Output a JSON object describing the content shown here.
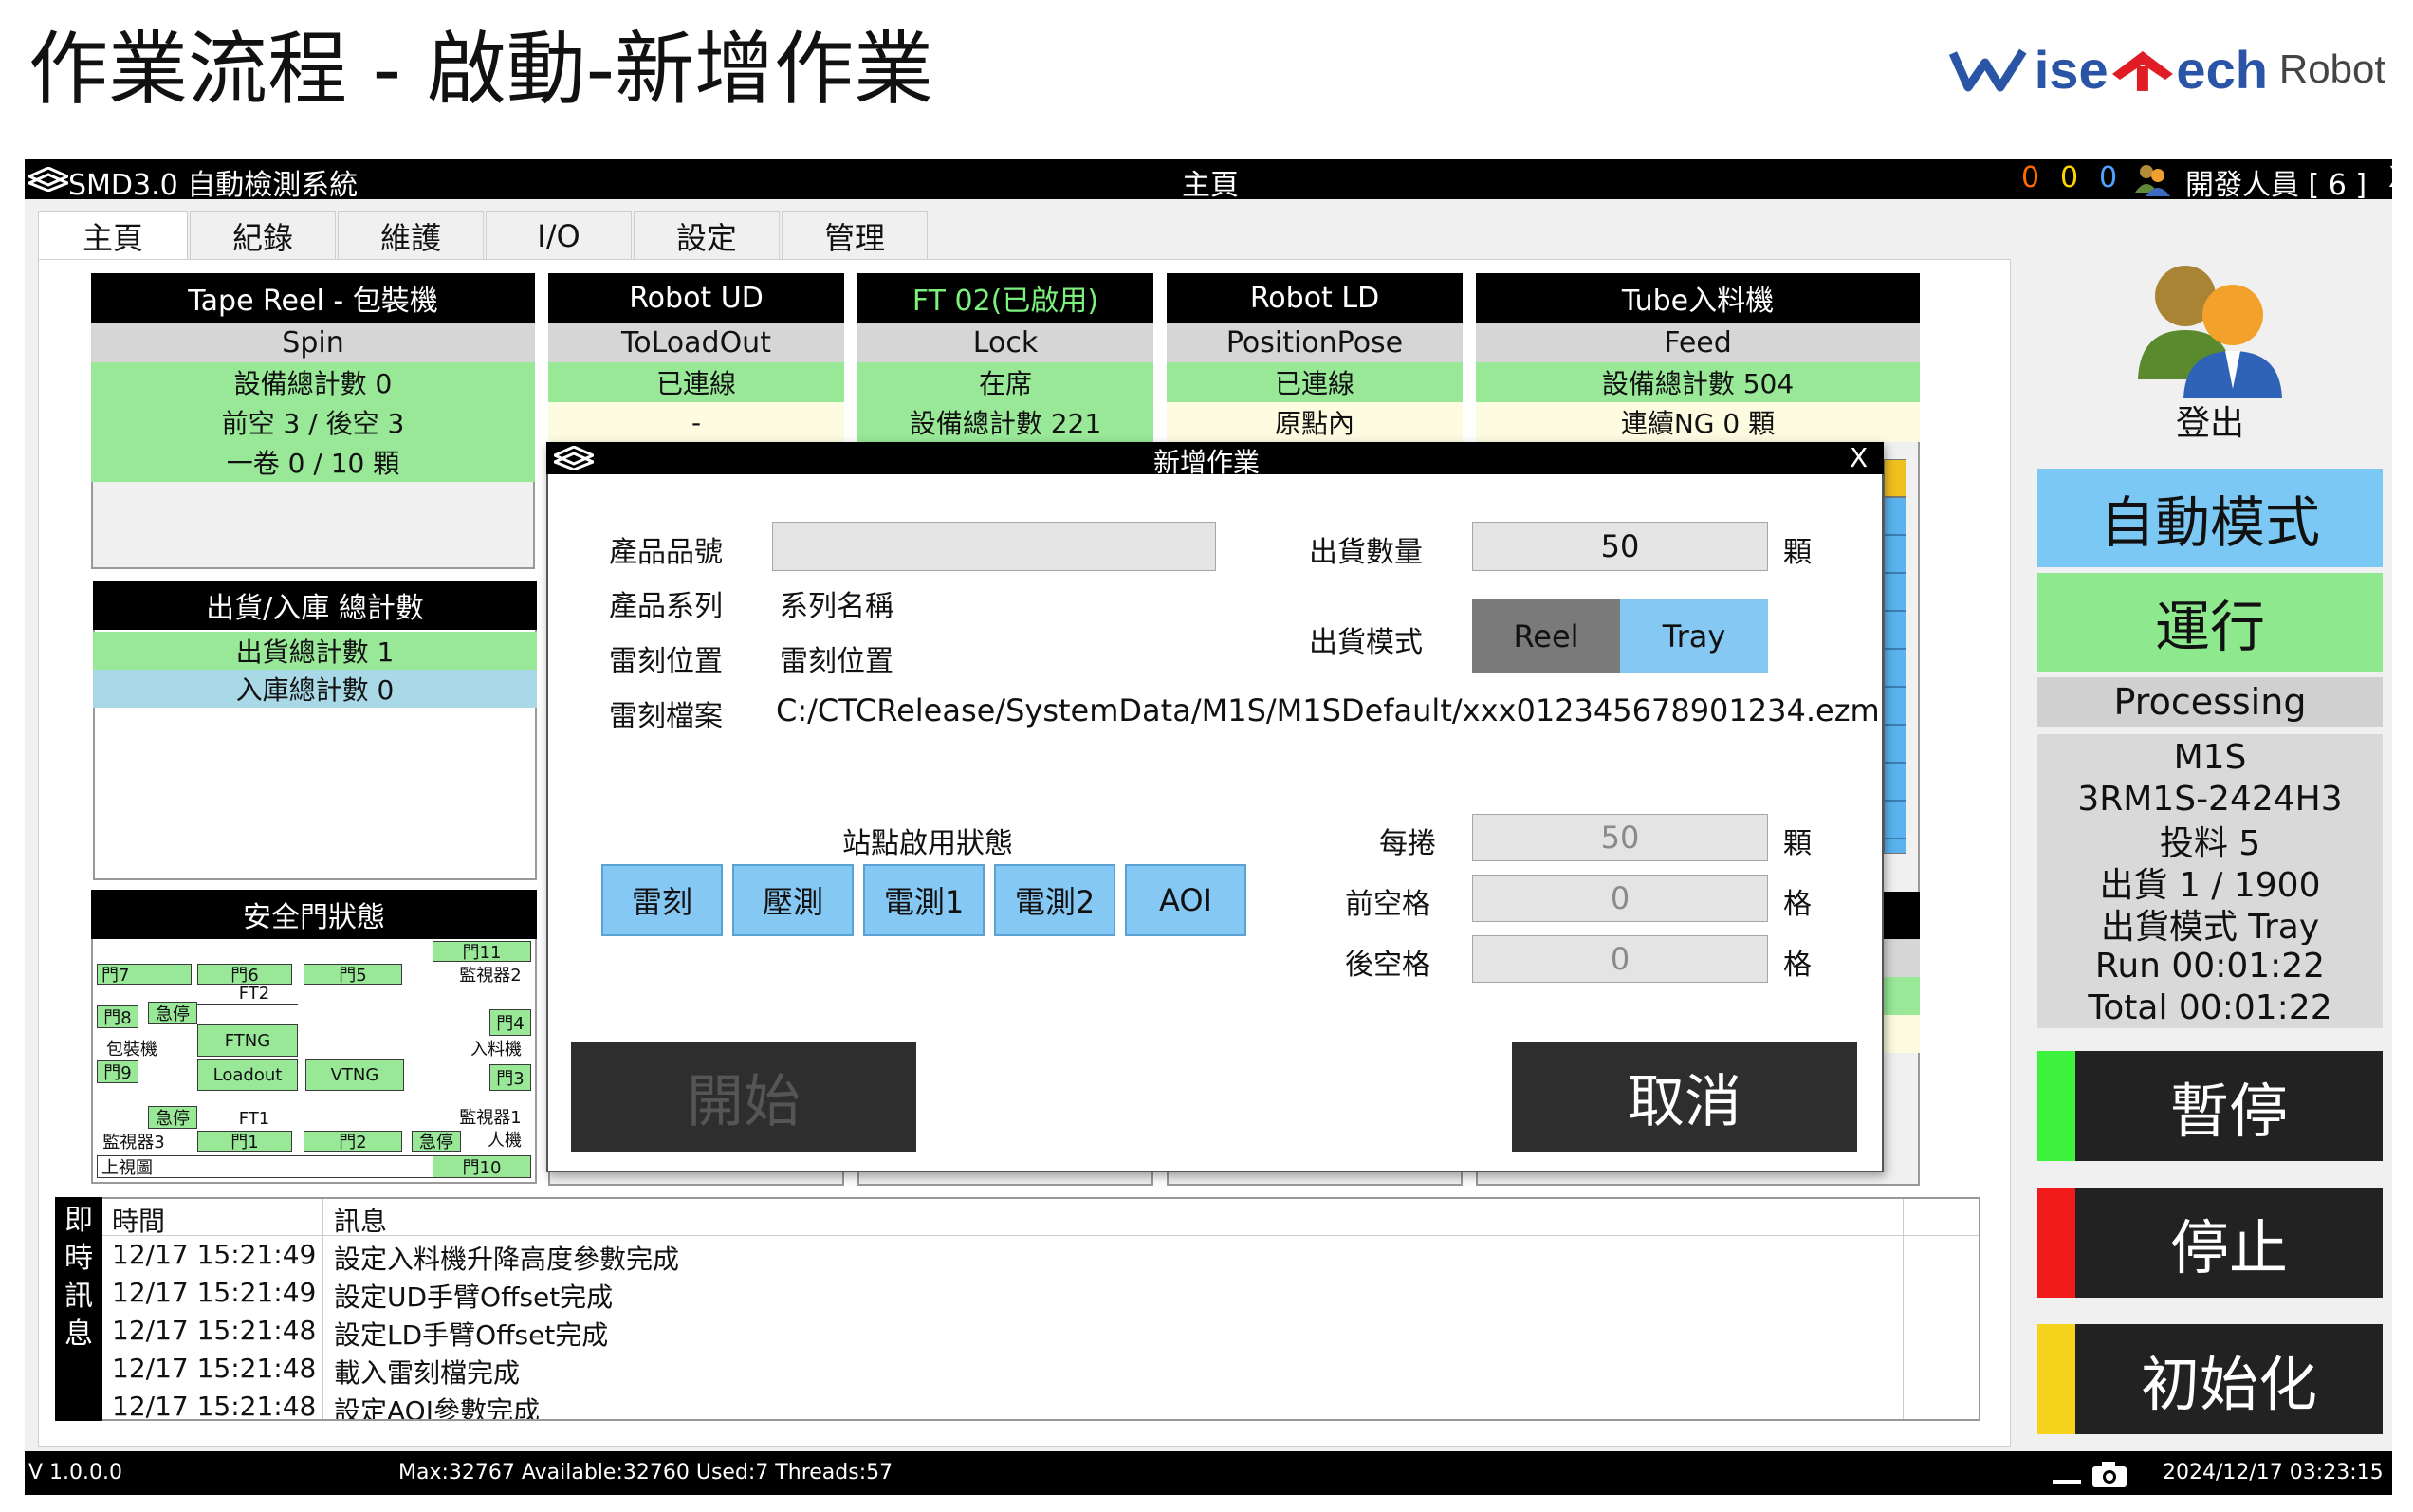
{
  "slide": {
    "title": "作業流程 - 啟動-新增作業",
    "logo": {
      "part1": "ise",
      "part2": "ech",
      "suffix": "Robot"
    }
  },
  "app": {
    "title": "SMD3.0 自動檢測系統",
    "center_title": "主頁",
    "counters": [
      "0",
      "0",
      "0"
    ],
    "counter_colors": [
      "#ff6a00",
      "#ffd400",
      "#4fa3ff"
    ],
    "user": "開發人員 [ 6 ]",
    "close": "X"
  },
  "tabs": [
    "主頁",
    "紀錄",
    "維護",
    "I/O",
    "設定",
    "管理"
  ],
  "stations": [
    {
      "header": "Tape Reel - 包裝機",
      "state": "Spin",
      "rows": [
        "設備總計數 0",
        "前空 3 / 後空 3",
        "一卷 0 / 10 顆"
      ]
    },
    {
      "header": "Robot UD",
      "state": "ToLoadOut",
      "rows": [
        "已連線",
        "-"
      ]
    },
    {
      "header": "FT 02(已啟用)",
      "state": "Lock",
      "rows": [
        "在席",
        "設備總計數 221"
      ]
    },
    {
      "header": "Robot LD",
      "state": "PositionPose",
      "rows": [
        "已連線",
        "原點內"
      ]
    },
    {
      "header": "Tube入料機",
      "state": "Feed",
      "rows": [
        "設備總計數 504",
        "連續NG 0 顆"
      ]
    }
  ],
  "totals": {
    "header": "出貨/入庫 總計數",
    "out": "出貨總計數 1",
    "in": "入庫總計數 0"
  },
  "safety": {
    "header": "安全門狀態",
    "labels": {
      "door11": "門11",
      "door7": "門7",
      "door6": "門6",
      "door5": "門5",
      "monitor2": "監視器2",
      "ft2": "FT2",
      "door8": "門8",
      "estop1": "急停",
      "door4": "門4",
      "packer": "包裝機",
      "ftng": "FTNG",
      "feeder": "入料機",
      "door9": "門9",
      "loadout": "Loadout",
      "vtng": "VTNG",
      "door3": "門3",
      "estop2": "急停",
      "ft1": "FT1",
      "monitor1": "監視器1",
      "monitor3": "監視器3",
      "door1": "門1",
      "door2": "門2",
      "estop3": "急停",
      "person": "人機",
      "topview": "上視圖",
      "door10": "門10"
    }
  },
  "dialog": {
    "title": "新增作業",
    "close": "X",
    "product_no_label": "產品品號",
    "product_no_value": "",
    "series_label": "產品系列",
    "series_value": "系列名稱",
    "laser_pos_label": "雷刻位置",
    "laser_pos_value": "雷刻位置",
    "laser_file_label": "雷刻檔案",
    "laser_file_value": "C:/CTCRelease/SystemData/M1S/M1SDefault/xxx012345678901234.ezm",
    "qty_label": "出貨數量",
    "qty_value": "50",
    "qty_unit": "顆",
    "mode_label": "出貨模式",
    "mode_reel": "Reel",
    "mode_tray": "Tray",
    "station_label": "站點啟用狀態",
    "station_buttons": [
      "雷刻",
      "壓測",
      "電測1",
      "電測2",
      "AOI"
    ],
    "per_reel_label": "每捲",
    "per_reel_value": "50",
    "per_reel_unit": "顆",
    "front_label": "前空格",
    "front_value": "0",
    "front_unit": "格",
    "back_label": "後空格",
    "back_value": "0",
    "back_unit": "格",
    "start_label": "開始",
    "cancel_label": "取消"
  },
  "log": {
    "side": [
      "即",
      "時",
      "訊",
      "息"
    ],
    "col_time": "時間",
    "col_msg": "訊息",
    "rows": [
      {
        "time": "12/17 15:21:49",
        "msg": "設定入料機升降高度參數完成"
      },
      {
        "time": "12/17 15:21:49",
        "msg": "設定UD手臂Offset完成"
      },
      {
        "time": "12/17 15:21:48",
        "msg": "設定LD手臂Offset完成"
      },
      {
        "time": "12/17 15:21:48",
        "msg": "載入雷刻檔完成"
      },
      {
        "time": "12/17 15:21:48",
        "msg": "設定AOI參數完成"
      }
    ]
  },
  "side": {
    "logout": "登出",
    "auto_mode": "自動模式",
    "run": "運行",
    "processing": "Processing",
    "info": [
      "M1S",
      "3RM1S-2424H3",
      "投料 5",
      "出貨 1 / 1900",
      "出貨模式 Tray",
      "Run 00:01:22",
      "Total 00:01:22"
    ],
    "pause": "暫停",
    "stop": "停止",
    "init": "初始化",
    "colors": {
      "pause": "#3df23d",
      "stop": "#f01a1a",
      "init": "#f5d21b",
      "auto": "#7cc8f4",
      "run": "#8ee88e"
    }
  },
  "status": {
    "version": "V 1.0.0.0",
    "memory": "Max:32767 Available:32760 Used:7 Threads:57",
    "datetime": "2024/12/17 03:23:15"
  }
}
